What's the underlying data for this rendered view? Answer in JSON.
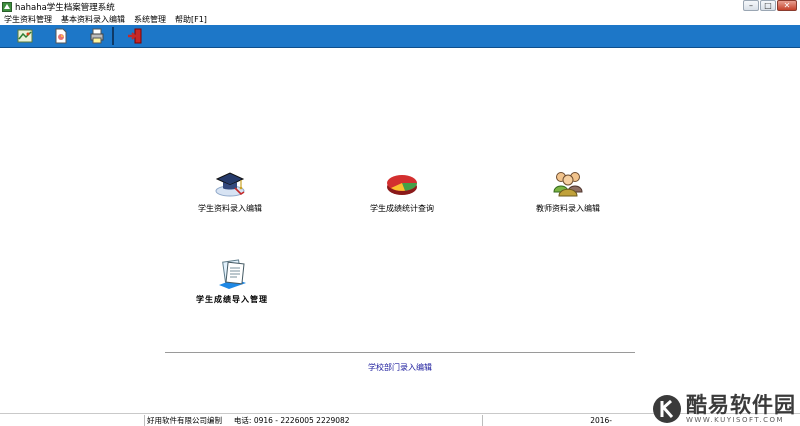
{
  "window": {
    "title": "hahaha学生档案管理系统",
    "app_icon": "app-icon",
    "controls": {
      "minimize": "–",
      "maximize": "□",
      "close": "✕"
    }
  },
  "menu": {
    "items": [
      {
        "label": "学生资料管理"
      },
      {
        "label": "基本资料录入编辑"
      },
      {
        "label": "系统管理"
      },
      {
        "label": "帮助[F1]"
      }
    ]
  },
  "toolbar": {
    "buttons": [
      {
        "icon": "map-icon"
      },
      {
        "icon": "document-icon"
      },
      {
        "icon": "printer-icon"
      },
      {
        "icon": "exit-door-icon"
      }
    ]
  },
  "modules": {
    "student_info": {
      "label": "学生资料录入编辑",
      "icon": "graduation-cap-icon"
    },
    "score_stats": {
      "label": "学生成绩统计查询",
      "icon": "pie-chart-icon"
    },
    "teacher_info": {
      "label": "教师资料录入编辑",
      "icon": "teachers-group-icon"
    },
    "score_import": {
      "label": "学生成绩导入管理",
      "icon": "report-sheets-icon"
    }
  },
  "dept_link": {
    "label": "学校部门录入编辑"
  },
  "statusbar": {
    "company": "好用软件有限公司编制",
    "phone": "电话:  0916 - 2226005    2229082",
    "date_partial": "2016-"
  },
  "watermark": {
    "text": "酷易软件园",
    "url": "WWW.KUYISOFT.COM"
  },
  "colors": {
    "toolbar_bg": "#1d77c8",
    "link": "#1a1a9c"
  }
}
